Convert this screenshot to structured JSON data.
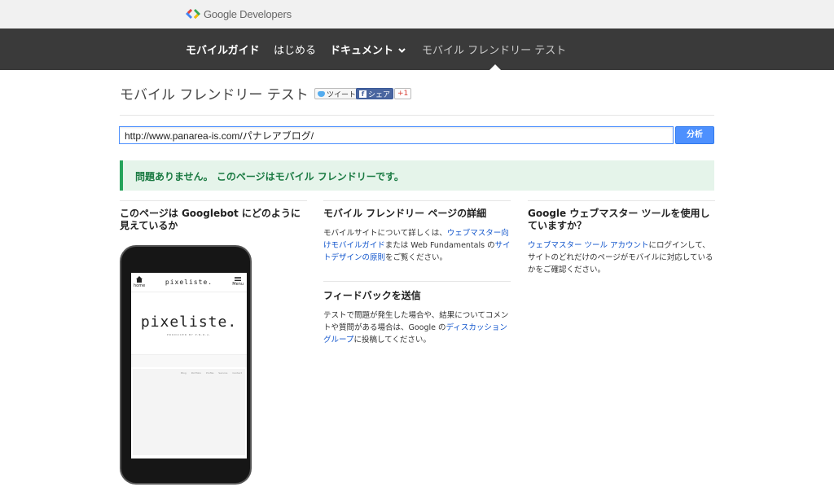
{
  "brand": {
    "name": "Google Developers"
  },
  "nav": {
    "items": [
      {
        "label": "モバイルガイド"
      },
      {
        "label": "はじめる"
      },
      {
        "label": "ドキュメント"
      },
      {
        "label": "モバイル フレンドリー テスト"
      }
    ]
  },
  "header": {
    "title": "モバイル フレンドリー テスト",
    "tweet": "ツイート",
    "share": "シェア",
    "plusone": "+1"
  },
  "form": {
    "url_value": "http://www.panarea-is.com/パナレアブログ/",
    "analyze_label": "分析"
  },
  "result": {
    "message": "問題ありません。 このページはモバイル フレンドリーです。"
  },
  "col1": {
    "heading": "このページは Googlebot にどのように見えているか"
  },
  "col2": {
    "heading": "モバイル フレンドリー ページの詳細",
    "text1": "モバイルサイトについて詳しくは、",
    "link1": "ウェブマスター向けモバイルガイド",
    "text2": "または Web Fundamentals の",
    "link2": "サイトデザインの原則",
    "text3": "をご覧ください。"
  },
  "col2b": {
    "heading": "フィードバックを送信",
    "text1": "テストで問題が発生した場合や、結果についてコメントや質問がある場合は、Google の",
    "link1": "ディスカッション グループ",
    "text2": "に投稿してください。"
  },
  "col3": {
    "heading": "Google ウェブマスター ツールを使用していますか？",
    "link1": "ウェブマスター ツール アカウント",
    "text1": "にログインして、サイトのどれだけのページがモバイルに対応しているかをご確認ください。"
  },
  "phone": {
    "site_brand": "pixeliste.",
    "home_label": "home",
    "menu_label": "Menu",
    "logo": "pixeliste.",
    "tagline": "PRODUCED BY P.N.R.A.",
    "links": "Blog Portfolio Profile Service Contact"
  }
}
